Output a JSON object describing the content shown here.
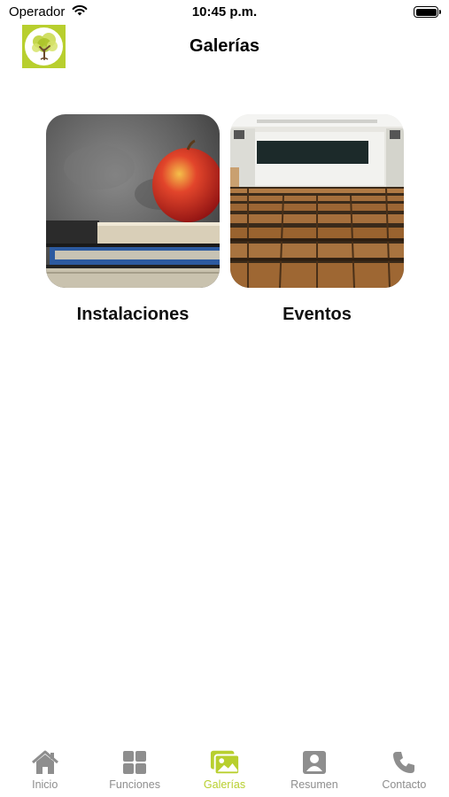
{
  "status_bar": {
    "carrier": "Operador",
    "time": "10:45 p.m."
  },
  "header": {
    "title": "Galerías"
  },
  "gallery": {
    "items": [
      {
        "label": "Instalaciones",
        "image": "apple-on-books"
      },
      {
        "label": "Eventos",
        "image": "lecture-hall-seats"
      }
    ]
  },
  "tab_bar": {
    "active_color": "#b8cf2e",
    "inactive_color": "#8e8e8e",
    "tabs": [
      {
        "label": "Inicio",
        "icon": "home-icon",
        "active": false
      },
      {
        "label": "Funciones",
        "icon": "grid-icon",
        "active": false
      },
      {
        "label": "Galerías",
        "icon": "gallery-icon",
        "active": true
      },
      {
        "label": "Resumen",
        "icon": "profile-card-icon",
        "active": false
      },
      {
        "label": "Contacto",
        "icon": "phone-icon",
        "active": false
      }
    ]
  }
}
